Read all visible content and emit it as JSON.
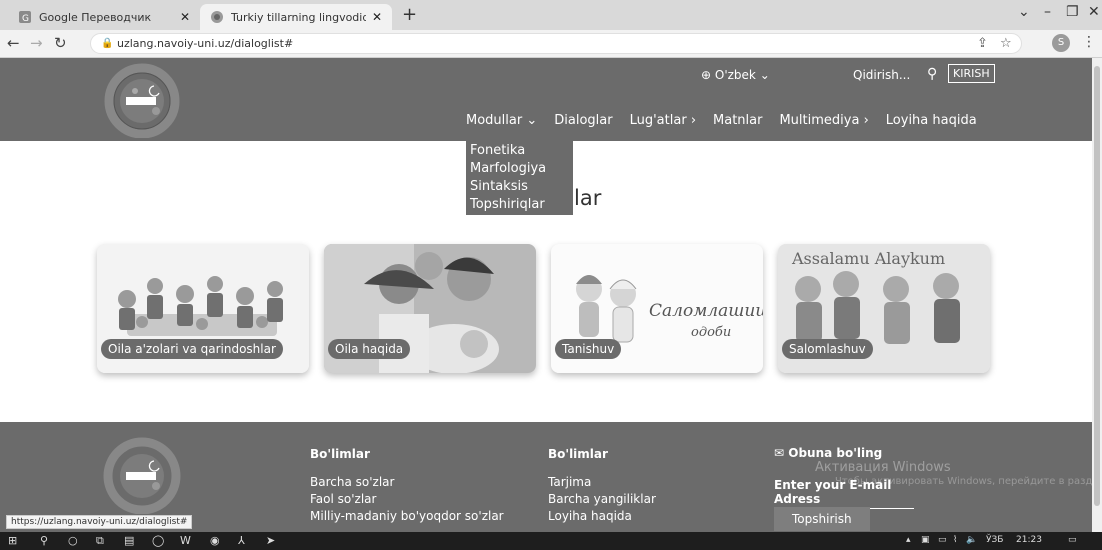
{
  "browser": {
    "tabs": [
      {
        "title": "Google Переводчик",
        "active": false
      },
      {
        "title": "Turkiy tillarning lingvodidaktik el",
        "active": true
      }
    ],
    "url": "uzlang.navoiy-uni.uz/dialoglist#",
    "profile_initial": "S",
    "status_url": "https://uzlang.navoiy-uni.uz/dialoglist#"
  },
  "header": {
    "language": "O'zbek",
    "search_label": "Qidirish...",
    "login_label": "KIRISH",
    "nav": [
      "Modullar",
      "Dialoglar",
      "Lug'atlar",
      "Matnlar",
      "Multimediya",
      "Loyiha haqida"
    ],
    "dropdown": [
      "Fonetika",
      "Marfologiya",
      "Sintaksis",
      "Topshiriqlar"
    ]
  },
  "page": {
    "title_visible": "lar",
    "cards": [
      {
        "label": "Oila a'zolari va qarindoshlar"
      },
      {
        "label": "Oila haqida"
      },
      {
        "label": "Tanishuv",
        "image_text_line1": "Саломлашиш",
        "image_text_line2": "одоби"
      },
      {
        "label": "Salomlashuv",
        "image_text": "Assalamu Alaykum"
      }
    ]
  },
  "footer": {
    "col1": {
      "heading": "Bo'limlar",
      "items": [
        "Barcha so'zlar",
        "Faol so'zlar",
        "Milliy-madaniy bo'yoqdor so'zlar"
      ]
    },
    "col2": {
      "heading": "Bo'limlar",
      "items": [
        "Tarjima",
        "Barcha yangiliklar",
        "Loyiha haqida"
      ]
    },
    "subscribe": "Obuna bo'ling",
    "email_placeholder": "Enter your E-mail Adress",
    "submit": "Topshirish",
    "watermark_title": "Активация Windows",
    "watermark_sub": "Чтобы активировать Windows, перейдите в раздел \"Параметры\"."
  },
  "taskbar": {
    "lang": "ЎЗБ",
    "time": "21:23"
  },
  "colors": {
    "header_bg": "#6b6b6b",
    "tab_bg": "#d9d9d9",
    "taskbar": "#1e1e1e"
  }
}
